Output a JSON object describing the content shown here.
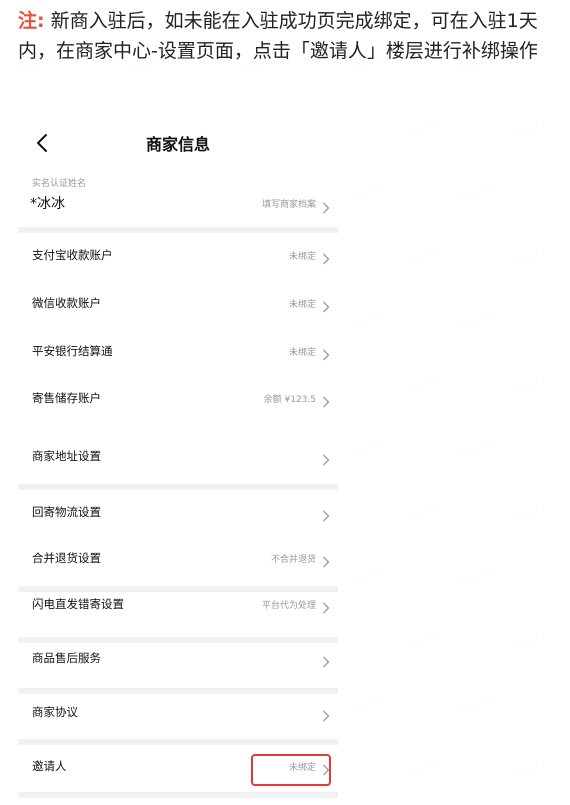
{
  "note": {
    "prefix": "注:",
    "text": " 新商入驻后，如未能在入驻成功页完成绑定，可在入驻1天内，在商家中心-设置页面，点击「邀请人」楼层进行补绑操作"
  },
  "header": {
    "title": "商家信息",
    "back_icon": "chevron-left-icon"
  },
  "name_block": {
    "caption": "实名认证姓名",
    "value": "*冰冰",
    "action": "填写商家档案"
  },
  "rows": [
    {
      "label": "支付宝收款账户",
      "value": "未绑定"
    },
    {
      "label": "微信收款账户",
      "value": "未绑定"
    },
    {
      "label": "平安银行结算通",
      "value": "未绑定"
    },
    {
      "label": "寄售储存账户",
      "value": "余额 ¥123.5"
    },
    {
      "label": "商家地址设置",
      "value": ""
    },
    {
      "label": "回寄物流设置",
      "value": ""
    },
    {
      "label": "合并退货设置",
      "value": "不合并退货"
    },
    {
      "label": "闪电直发错寄设置",
      "value": "平台代为处理"
    },
    {
      "label": "商品售后服务",
      "value": ""
    },
    {
      "label": "商家协议",
      "value": ""
    },
    {
      "label": "邀请人",
      "value": "未绑定"
    }
  ],
  "colors": {
    "accent": "#e8533b",
    "highlight_border": "#e53935",
    "divider": "#f1f1f1",
    "secondary_text": "#999999"
  }
}
